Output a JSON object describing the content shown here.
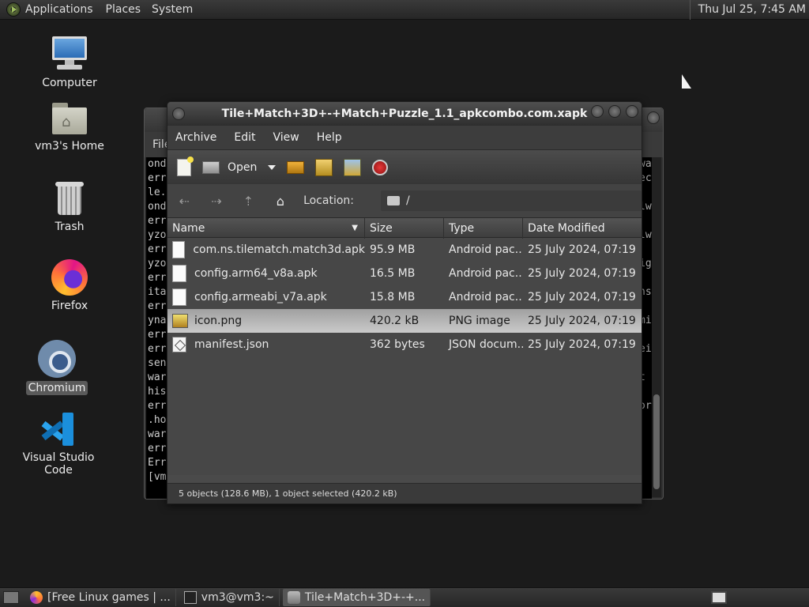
{
  "top_panel": {
    "menus": [
      "Applications",
      "Places",
      "System"
    ],
    "clock": "Thu Jul 25,  7:45 AM"
  },
  "desktop": {
    "icons": [
      {
        "label": "Computer",
        "icon": "computer-icon"
      },
      {
        "label": "vm3's Home",
        "icon": "home-folder-icon"
      },
      {
        "label": "Trash",
        "icon": "trash-icon"
      },
      {
        "label": "Firefox",
        "icon": "firefox-icon"
      },
      {
        "label": "Chromium",
        "icon": "chromium-icon",
        "selected": true
      },
      {
        "label": "Visual Studio Code",
        "icon": "vscode-icon"
      }
    ]
  },
  "terminal": {
    "menu_first": "File",
    "lines": [
      "ond",
      "err",
      "le.",
      "ond",
      "err",
      "yzo",
      "err",
      "yzo",
      "err",
      "ita",
      "err",
      "yna",
      "err",
      "err",
      "sen",
      "war",
      "his",
      "err",
      ".ho",
      "war",
      "err",
      "Err",
      "[vm"
    ],
    "right_lines": [
      "wa",
      "ec",
      "",
      "lw",
      "",
      "lw",
      "",
      "ig",
      "",
      "ns",
      "",
      "mi",
      "",
      "ei",
      "",
      "t",
      "",
      "or"
    ]
  },
  "archive": {
    "title": "Tile+Match+3D+-+Match+Puzzle_1.1_apkcombo.com.xapk",
    "menu": [
      "Archive",
      "Edit",
      "View",
      "Help"
    ],
    "toolbar": {
      "open_label": "Open"
    },
    "location": {
      "label": "Location:",
      "path": "/"
    },
    "columns": {
      "name": "Name",
      "size": "Size",
      "type": "Type",
      "date": "Date Modified"
    },
    "files": [
      {
        "name": "com.ns.tilematch.match3d.apk",
        "size": "95.9 MB",
        "type": "Android pac...",
        "date": "25 July 2024, 07:19",
        "icon": "document-icon"
      },
      {
        "name": "config.arm64_v8a.apk",
        "size": "16.5 MB",
        "type": "Android pac...",
        "date": "25 July 2024, 07:19",
        "icon": "document-icon"
      },
      {
        "name": "config.armeabi_v7a.apk",
        "size": "15.8 MB",
        "type": "Android pac...",
        "date": "25 July 2024, 07:19",
        "icon": "document-icon"
      },
      {
        "name": "icon.png",
        "size": "420.2 kB",
        "type": "PNG image",
        "date": "25 July 2024, 07:19",
        "icon": "image-icon",
        "selected": true
      },
      {
        "name": "manifest.json",
        "size": "362 bytes",
        "type": "JSON docum...",
        "date": "25 July 2024, 07:19",
        "icon": "json-icon"
      }
    ],
    "status": "5 objects (128.6 MB), 1 object selected (420.2 kB)"
  },
  "bottom_panel": {
    "tasks": [
      {
        "label": "[Free Linux games | ...",
        "icon": "firefox-icon"
      },
      {
        "label": "vm3@vm3:~",
        "icon": "terminal-icon"
      },
      {
        "label": "Tile+Match+3D+-+...",
        "icon": "archive-icon",
        "active": true
      }
    ]
  }
}
